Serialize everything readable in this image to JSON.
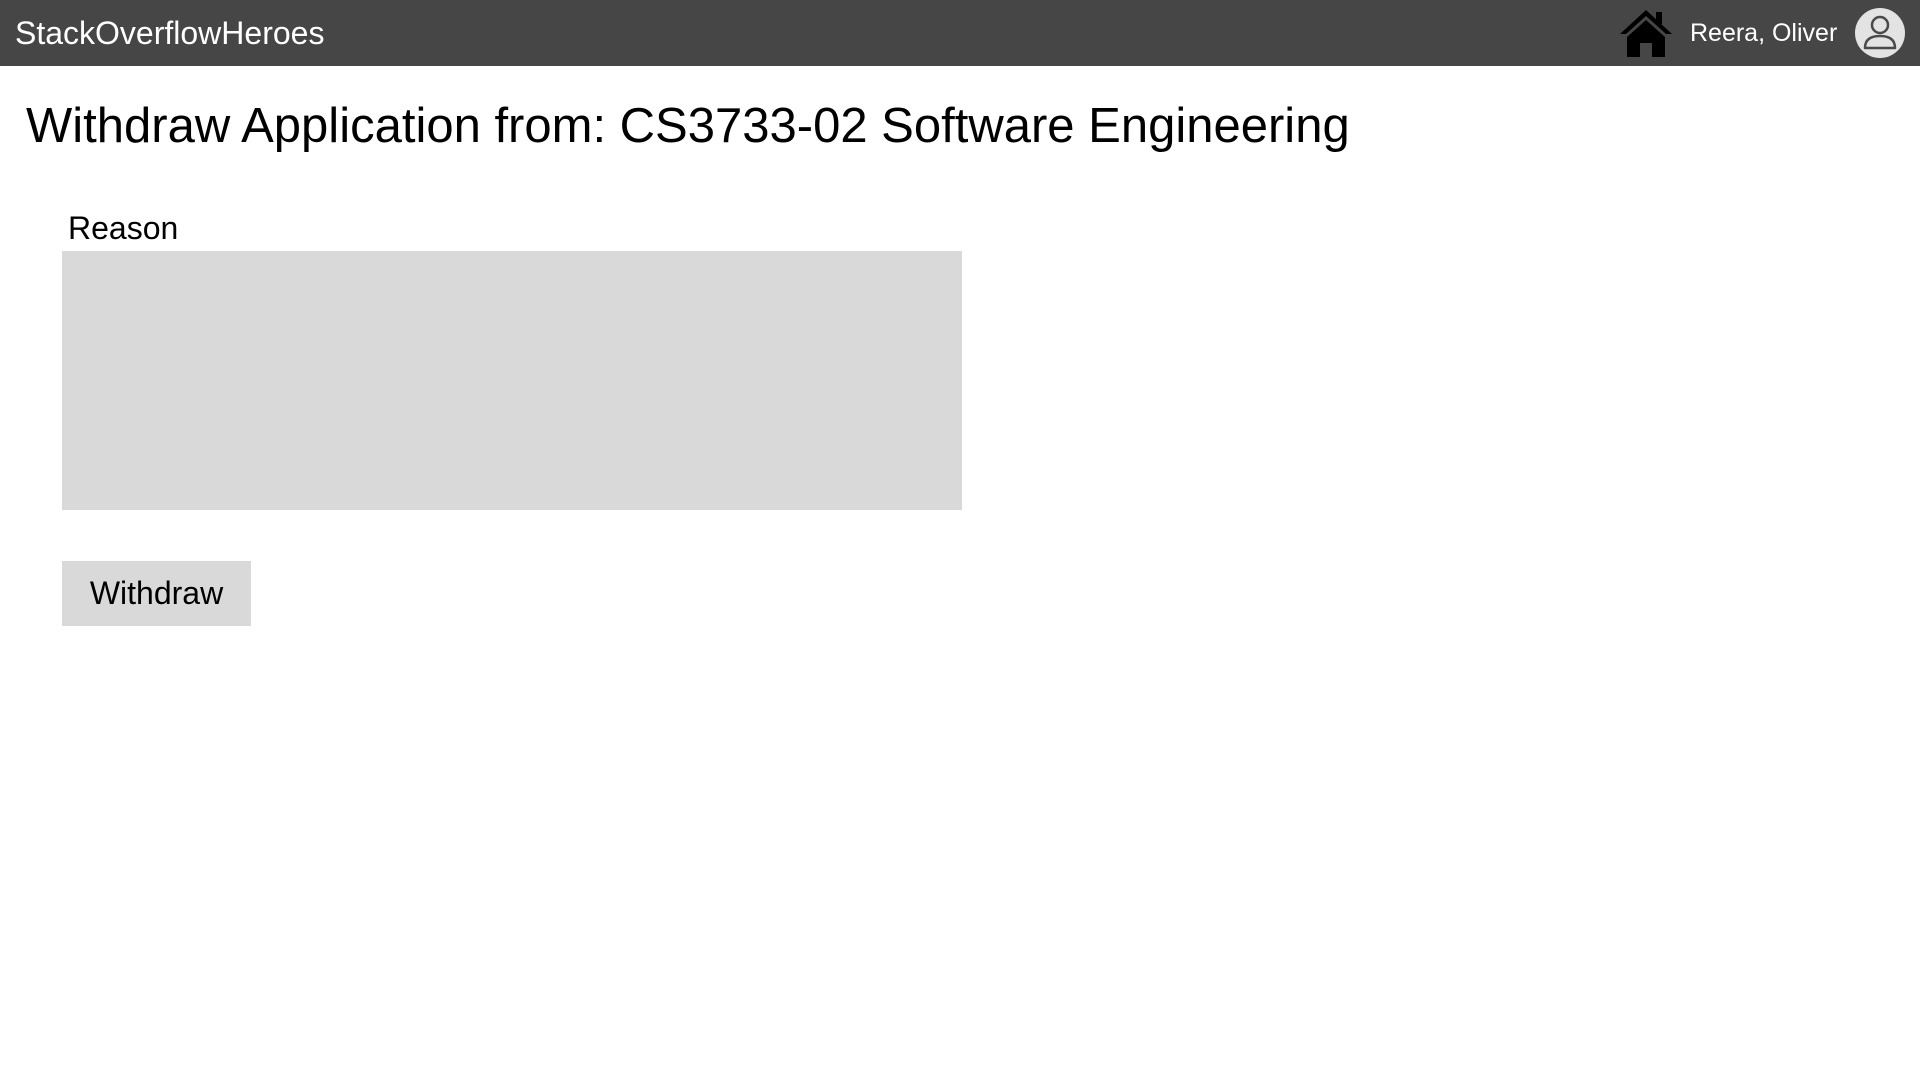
{
  "header": {
    "brand": "StackOverflowHeroes",
    "home_icon": "home-icon",
    "user_name": "Reera, Oliver",
    "avatar_icon": "user-avatar-icon",
    "background_color": "#464646"
  },
  "main": {
    "title": "Withdraw Application from: CS3733-02 Software Engineering",
    "reason_label": "Reason",
    "reason_value": "",
    "withdraw_label": "Withdraw"
  }
}
